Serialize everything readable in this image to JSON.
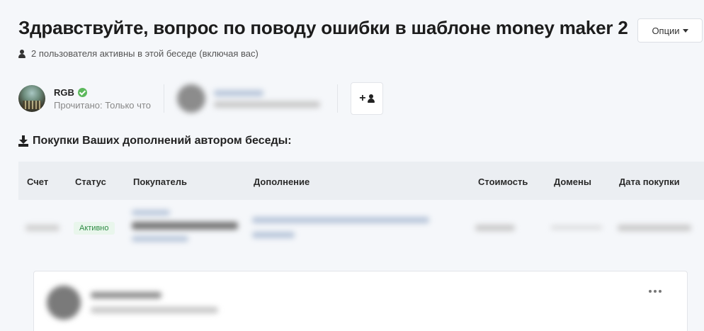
{
  "header": {
    "title": "Здравствуйте, вопрос по поводу ошибки в шаблоне money maker 2",
    "options_label": "Опции",
    "active_users_text": "2 пользователя активны в этой беседе (включая вас)"
  },
  "participants": [
    {
      "name": "RGB",
      "status": "Прочитано: Только что",
      "verified": true
    }
  ],
  "purchases": {
    "section_title": "Покупки Ваших дополнений автором беседы:",
    "columns": [
      "Счет",
      "Статус",
      "Покупатель",
      "Дополнение",
      "Стоимость",
      "Домены",
      "Дата покупки"
    ],
    "rows": [
      {
        "status": "Активно"
      }
    ]
  },
  "colors": {
    "background": "#f5f7fa",
    "badge_green": "#2e8b44",
    "verified_green": "#5cb85c"
  }
}
